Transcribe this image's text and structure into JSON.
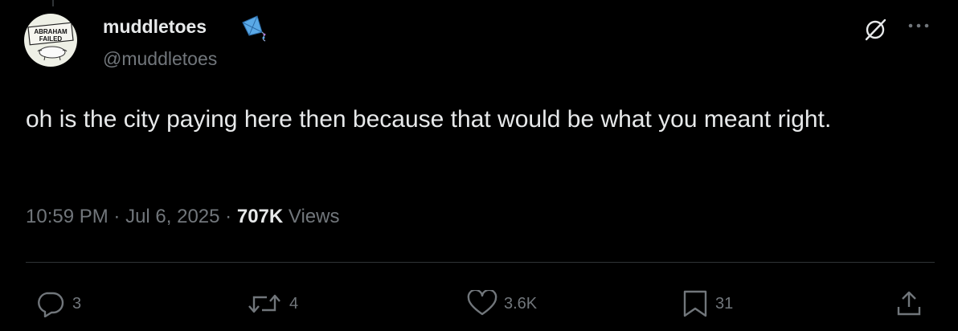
{
  "author": {
    "display_name": "muddletoes",
    "handle": "@muddletoes",
    "badge_icon": "kite-emoji",
    "avatar": {
      "line1": "ABRAHAM",
      "line2": "FAILED"
    }
  },
  "header_icons": [
    "grok-icon",
    "more-icon"
  ],
  "tweet": {
    "text": "oh is the city paying here then because that would be what you meant right.",
    "time": "10:59 PM",
    "date": "Jul 6, 2025",
    "separator": "·",
    "views_count": "707K",
    "views_label": "Views"
  },
  "actions": {
    "replies": "3",
    "reposts": "4",
    "likes": "3.6K",
    "bookmarks": "31"
  },
  "colors": {
    "background": "#000000",
    "text": "#e7e9ea",
    "muted": "#71767b",
    "divider": "#2f3336"
  }
}
